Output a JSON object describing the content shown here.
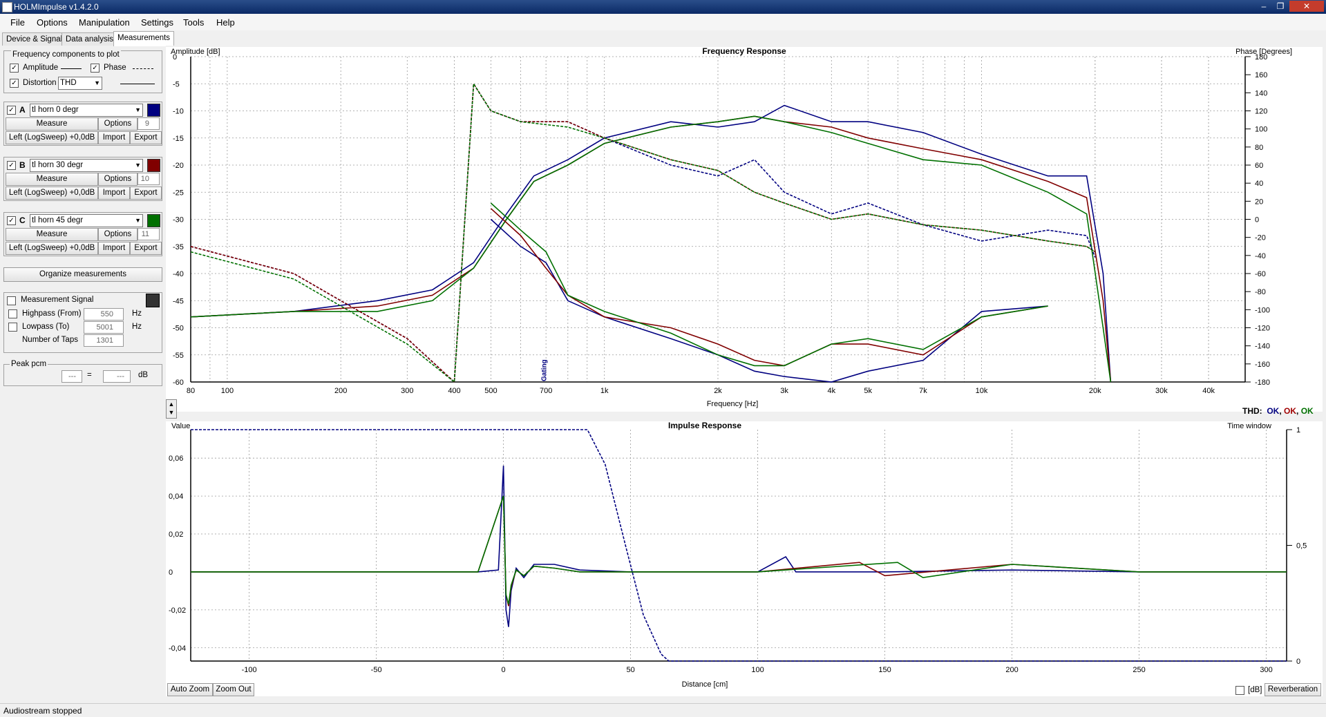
{
  "window": {
    "title": "HOLMImpulse  v1.4.2.0"
  },
  "menu": [
    "File",
    "Options",
    "Manipulation",
    "Settings",
    "Tools",
    "Help"
  ],
  "tabs": [
    "Device & Signal",
    "Data analysis",
    "Measurements"
  ],
  "freq_components": {
    "title": "Frequency components to plot",
    "amplitude_label": "Amplitude",
    "phase_label": "Phase",
    "distortion_label": "Distortion",
    "distortion_value": "THD"
  },
  "measurements": [
    {
      "letter": "A",
      "name": "tl horn 0 degr",
      "color": "#000080",
      "measure": "Measure",
      "options": "Options",
      "spin": "9",
      "channel": "Left (LogSweep) +0,0dB",
      "import": "Import",
      "export": "Export"
    },
    {
      "letter": "B",
      "name": "tl horn 30 degr",
      "color": "#800000",
      "measure": "Measure",
      "options": "Options",
      "spin": "10",
      "channel": "Left (LogSweep) +0,0dB",
      "import": "Import",
      "export": "Export"
    },
    {
      "letter": "C",
      "name": "tl horn 45 degr",
      "color": "#007000",
      "measure": "Measure",
      "options": "Options",
      "spin": "11",
      "channel": "Left (LogSweep) +0,0dB",
      "import": "Import",
      "export": "Export"
    }
  ],
  "organize": "Organize measurements",
  "signal": {
    "label": "Measurement Signal",
    "highpass": "Highpass (From)",
    "highpass_val": "550",
    "hz1": "Hz",
    "lowpass": "Lowpass (To)",
    "lowpass_val": "5001",
    "hz2": "Hz",
    "taps": "Number of Taps",
    "taps_val": "1301"
  },
  "peak": {
    "label": "Peak pcm",
    "v1": "---",
    "eq": "=",
    "v2": "---",
    "unit": "dB"
  },
  "thd_status": {
    "label": "THD:",
    "values": [
      "OK",
      "OK",
      "OK"
    ]
  },
  "buttons": {
    "auto_zoom": "Auto Zoom",
    "zoom_out": "Zoom Out",
    "db": "[dB]",
    "reverberation": "Reverberation"
  },
  "status": "Audiostream stopped",
  "chart_data": [
    {
      "type": "line",
      "title": "Frequency Response",
      "xlabel": "Frequency [Hz]",
      "ylabel": "Amplitude [dB]",
      "y2label": "Phase [Degrees]",
      "xscale": "log",
      "xlim": [
        80,
        50000
      ],
      "ylim": [
        -60,
        0
      ],
      "y2lim": [
        -180,
        180
      ],
      "xticks": [
        80,
        100,
        200,
        300,
        400,
        500,
        700,
        1000,
        2000,
        3000,
        4000,
        5000,
        7000,
        10000,
        20000,
        30000,
        40000
      ],
      "xticklabels": [
        "80",
        "100",
        "200",
        "300",
        "400",
        "500",
        "700",
        "1k",
        "2k",
        "3k",
        "4k",
        "5k",
        "7k",
        "10k",
        "20k",
        "30k",
        "40k"
      ],
      "yticks": [
        0,
        -5,
        -10,
        -15,
        -20,
        -25,
        -30,
        -35,
        -40,
        -45,
        -50,
        -55,
        -60
      ],
      "y2ticks": [
        180,
        160,
        140,
        120,
        100,
        80,
        60,
        40,
        20,
        0,
        -20,
        -40,
        -60,
        -80,
        -100,
        -120,
        -140,
        -160,
        -180
      ],
      "annotation": "Gating",
      "grid": true,
      "series": [
        {
          "name": "tl horn 0 degr amplitude",
          "color": "#000080",
          "style": "solid",
          "x": [
            80,
            150,
            250,
            350,
            450,
            550,
            650,
            800,
            1000,
            1500,
            2000,
            2500,
            3000,
            4000,
            5000,
            7000,
            10000,
            15000,
            19000,
            21000,
            22000
          ],
          "y": [
            -48,
            -47,
            -45,
            -43,
            -38,
            -29,
            -22,
            -19,
            -15,
            -12,
            -13,
            -12,
            -9,
            -12,
            -12,
            -14,
            -18,
            -22,
            -22,
            -40,
            -60
          ]
        },
        {
          "name": "tl horn 30 degr amplitude",
          "color": "#800000",
          "style": "solid",
          "x": [
            80,
            150,
            250,
            350,
            450,
            550,
            650,
            800,
            1000,
            1500,
            2000,
            2500,
            3000,
            4000,
            5000,
            7000,
            10000,
            15000,
            19000,
            21000,
            22000
          ],
          "y": [
            -48,
            -47,
            -46,
            -44,
            -39,
            -30,
            -23,
            -20,
            -16,
            -13,
            -12,
            -11,
            -12,
            -13,
            -15,
            -17,
            -19,
            -23,
            -26,
            -45,
            -60
          ]
        },
        {
          "name": "tl horn 45 degr amplitude",
          "color": "#007000",
          "style": "solid",
          "x": [
            80,
            150,
            250,
            350,
            450,
            550,
            650,
            800,
            1000,
            1500,
            2000,
            2500,
            3000,
            4000,
            5000,
            7000,
            10000,
            15000,
            19000,
            21000,
            22000
          ],
          "y": [
            -48,
            -47,
            -47,
            -45,
            -39,
            -30,
            -23,
            -20,
            -16,
            -13,
            -12,
            -11,
            -12,
            -14,
            -16,
            -19,
            -20,
            -25,
            -29,
            -50,
            -60
          ]
        },
        {
          "name": "tl horn 0 degr phase",
          "color": "#000080",
          "style": "dashed",
          "x": [
            80,
            150,
            200,
            300,
            400,
            450,
            500,
            600,
            800,
            1000,
            1500,
            2000,
            2500,
            3000,
            4000,
            5000,
            7000,
            10000,
            15000,
            19000,
            20000
          ],
          "y": [
            -35,
            -40,
            -45,
            -52,
            -60,
            -5,
            -10,
            -12,
            -12,
            -15,
            -20,
            -22,
            -19,
            -25,
            -29,
            -27,
            -31,
            -34,
            -32,
            -33,
            -37
          ]
        },
        {
          "name": "tl horn 30 degr phase",
          "color": "#800000",
          "style": "dashed",
          "x": [
            80,
            150,
            200,
            300,
            400,
            450,
            500,
            600,
            800,
            1000,
            1500,
            2000,
            2500,
            3000,
            4000,
            5000,
            7000,
            10000,
            15000,
            19000,
            20000
          ],
          "y": [
            -35,
            -40,
            -45,
            -52,
            -60,
            -5,
            -10,
            -12,
            -12,
            -15,
            -19,
            -21,
            -25,
            -27,
            -30,
            -29,
            -31,
            -32,
            -34,
            -35,
            -36
          ]
        },
        {
          "name": "tl horn 45 degr phase",
          "color": "#007000",
          "style": "dashed",
          "x": [
            80,
            150,
            200,
            300,
            400,
            450,
            500,
            600,
            800,
            1000,
            1500,
            2000,
            2500,
            3000,
            4000,
            5000,
            7000,
            10000,
            15000,
            19000,
            20000
          ],
          "y": [
            -36,
            -41,
            -46,
            -53,
            -60,
            -5,
            -10,
            -12,
            -13,
            -15,
            -19,
            -21,
            -25,
            -27,
            -30,
            -29,
            -31,
            -32,
            -34,
            -35,
            -36
          ]
        },
        {
          "name": "tl horn 0 degr THD",
          "color": "#000080",
          "style": "solid",
          "x": [
            500,
            600,
            700,
            800,
            1000,
            1500,
            2000,
            2500,
            3000,
            4000,
            5000,
            7000,
            10000,
            15000
          ],
          "y": [
            -30,
            -35,
            -38,
            -45,
            -48,
            -52,
            -55,
            -58,
            -59,
            -60,
            -58,
            -56,
            -47,
            -46
          ]
        },
        {
          "name": "tl horn 30 degr THD",
          "color": "#800000",
          "style": "solid",
          "x": [
            500,
            600,
            700,
            800,
            1000,
            1500,
            2000,
            2500,
            3000,
            4000,
            5000,
            7000,
            10000,
            15000
          ],
          "y": [
            -28,
            -33,
            -39,
            -44,
            -48,
            -50,
            -53,
            -56,
            -57,
            -53,
            -53,
            -55,
            -48,
            -46
          ]
        },
        {
          "name": "tl horn 45 degr THD",
          "color": "#007000",
          "style": "solid",
          "x": [
            500,
            600,
            700,
            800,
            1000,
            1500,
            2000,
            2500,
            3000,
            4000,
            5000,
            7000,
            10000,
            15000
          ],
          "y": [
            -27,
            -32,
            -36,
            -44,
            -47,
            -51,
            -55,
            -57,
            -57,
            -53,
            -52,
            -54,
            -48,
            -46
          ]
        }
      ]
    },
    {
      "type": "line",
      "title": "Impulse Response",
      "xlabel": "Distance [cm]",
      "ylabel": "Value",
      "y2label": "Time window",
      "xlim": [
        -123,
        308
      ],
      "ylim": [
        -0.047,
        0.075
      ],
      "y2lim": [
        0,
        1
      ],
      "xticks": [
        -100,
        -50,
        0,
        50,
        100,
        150,
        200,
        250,
        300
      ],
      "yticks": [
        0.06,
        0.04,
        0.02,
        0,
        -0.02,
        -0.04
      ],
      "yticklabels": [
        "0,06",
        "0,04",
        "0,02",
        "0",
        "-0,02",
        "-0,04"
      ],
      "y2ticks": [
        1,
        0.5,
        0
      ],
      "y2ticklabels": [
        "1",
        "0,5",
        "0"
      ],
      "grid": true,
      "series": [
        {
          "name": "tl horn 0 degr",
          "color": "#000080",
          "style": "solid",
          "x": [
            -123,
            -10,
            -2,
            0,
            1,
            2,
            3,
            5,
            8,
            12,
            20,
            30,
            50,
            100,
            111,
            115,
            150,
            200,
            250,
            308
          ],
          "y": [
            0,
            0,
            0.001,
            0.056,
            -0.02,
            -0.029,
            -0.01,
            0.002,
            -0.003,
            0.004,
            0.004,
            0.001,
            0,
            0,
            0.008,
            0,
            0,
            0.001,
            0,
            0
          ]
        },
        {
          "name": "tl horn 30 degr",
          "color": "#800000",
          "style": "solid",
          "x": [
            -123,
            -10,
            0,
            1,
            2,
            3,
            5,
            8,
            12,
            20,
            30,
            50,
            100,
            140,
            150,
            200,
            250,
            308
          ],
          "y": [
            0,
            0,
            0.04,
            -0.012,
            -0.018,
            -0.008,
            0.001,
            -0.002,
            0.003,
            0.002,
            0,
            0,
            0,
            0.005,
            -0.002,
            0.004,
            0,
            0
          ]
        },
        {
          "name": "tl horn 45 degr",
          "color": "#007000",
          "style": "solid",
          "x": [
            -123,
            -10,
            0,
            1,
            2,
            3,
            5,
            8,
            12,
            20,
            30,
            50,
            100,
            155,
            165,
            200,
            250,
            308
          ],
          "y": [
            0,
            0,
            0.04,
            -0.012,
            -0.017,
            -0.007,
            0.001,
            -0.002,
            0.003,
            0.002,
            0,
            0,
            0,
            0.005,
            -0.003,
            0.004,
            0,
            0
          ]
        },
        {
          "name": "Time window",
          "color": "#000080",
          "style": "dashed",
          "axis": "y2",
          "x": [
            -123,
            0,
            0,
            33,
            40,
            48,
            55,
            62,
            65,
            308
          ],
          "y": [
            1,
            1,
            1,
            1,
            0.85,
            0.5,
            0.2,
            0.03,
            0,
            0
          ]
        }
      ]
    }
  ]
}
